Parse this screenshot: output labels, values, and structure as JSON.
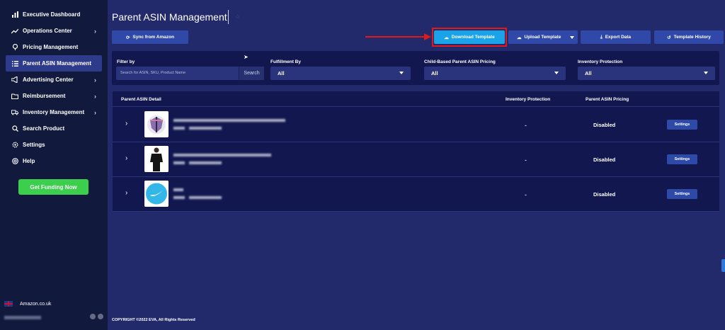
{
  "sidebar": {
    "items": [
      {
        "label": "Executive Dashboard",
        "icon": "bar-chart-icon",
        "chevron": false,
        "active": false
      },
      {
        "label": "Operations Center",
        "icon": "trend-icon",
        "chevron": true,
        "active": false
      },
      {
        "label": "Pricing Management",
        "icon": "tag-icon",
        "chevron": false,
        "active": false
      },
      {
        "label": "Parent ASIN Management",
        "icon": "list-icon",
        "chevron": false,
        "active": true
      },
      {
        "label": "Advertising Center",
        "icon": "megaphone-icon",
        "chevron": true,
        "active": false
      },
      {
        "label": "Reimbursement",
        "icon": "folder-icon",
        "chevron": true,
        "active": false
      },
      {
        "label": "Inventory Management",
        "icon": "truck-icon",
        "chevron": true,
        "active": false
      },
      {
        "label": "Search Product",
        "icon": "search-icon",
        "chevron": false,
        "active": false
      },
      {
        "label": "Settings",
        "icon": "gear-icon",
        "chevron": false,
        "active": false
      },
      {
        "label": "Help",
        "icon": "lifebuoy-icon",
        "chevron": false,
        "active": false
      }
    ],
    "funding_label": "Get Funding Now",
    "store_label": "Amazon.co.uk"
  },
  "header": {
    "title": "Parent ASIN Management"
  },
  "toolbar": {
    "sync_label": "Sync from Amazon",
    "download_label": "Download Template",
    "upload_label": "Upload Template",
    "export_label": "Export Data",
    "history_label": "Template History"
  },
  "filters": {
    "filter_by_label": "Filter by",
    "search_placeholder": "Search for ASIN, SKU, Product Name",
    "search_button": "Search",
    "fulfillment_label": "Fulfillment By",
    "fulfillment_value": "All",
    "pricing_label": "Child-Based Parent ASIN Pricing",
    "pricing_value": "All",
    "protection_label": "Inventory Protection",
    "protection_value": "All"
  },
  "table": {
    "columns": [
      "Parent ASIN Detail",
      "Inventory Protection",
      "Parent ASIN Pricing"
    ],
    "rows": [
      {
        "protection": "-",
        "pricing": "Disabled",
        "action": "Settings"
      },
      {
        "protection": "-",
        "pricing": "Disabled",
        "action": "Settings"
      },
      {
        "protection": "-",
        "pricing": "Disabled",
        "action": "Settings"
      }
    ]
  },
  "footer": {
    "copyright": "COPYRIGHT ©2022 EVA, All Rights Reserved"
  },
  "colors": {
    "sidebar_bg": "#111a3d",
    "main_bg": "#232a6b",
    "panel_bg": "#12184f",
    "button_bg": "#3049a9",
    "accent_blue": "#1aa3e8",
    "funding_green": "#3ccf4e",
    "annotation_red": "#e01a1a"
  }
}
